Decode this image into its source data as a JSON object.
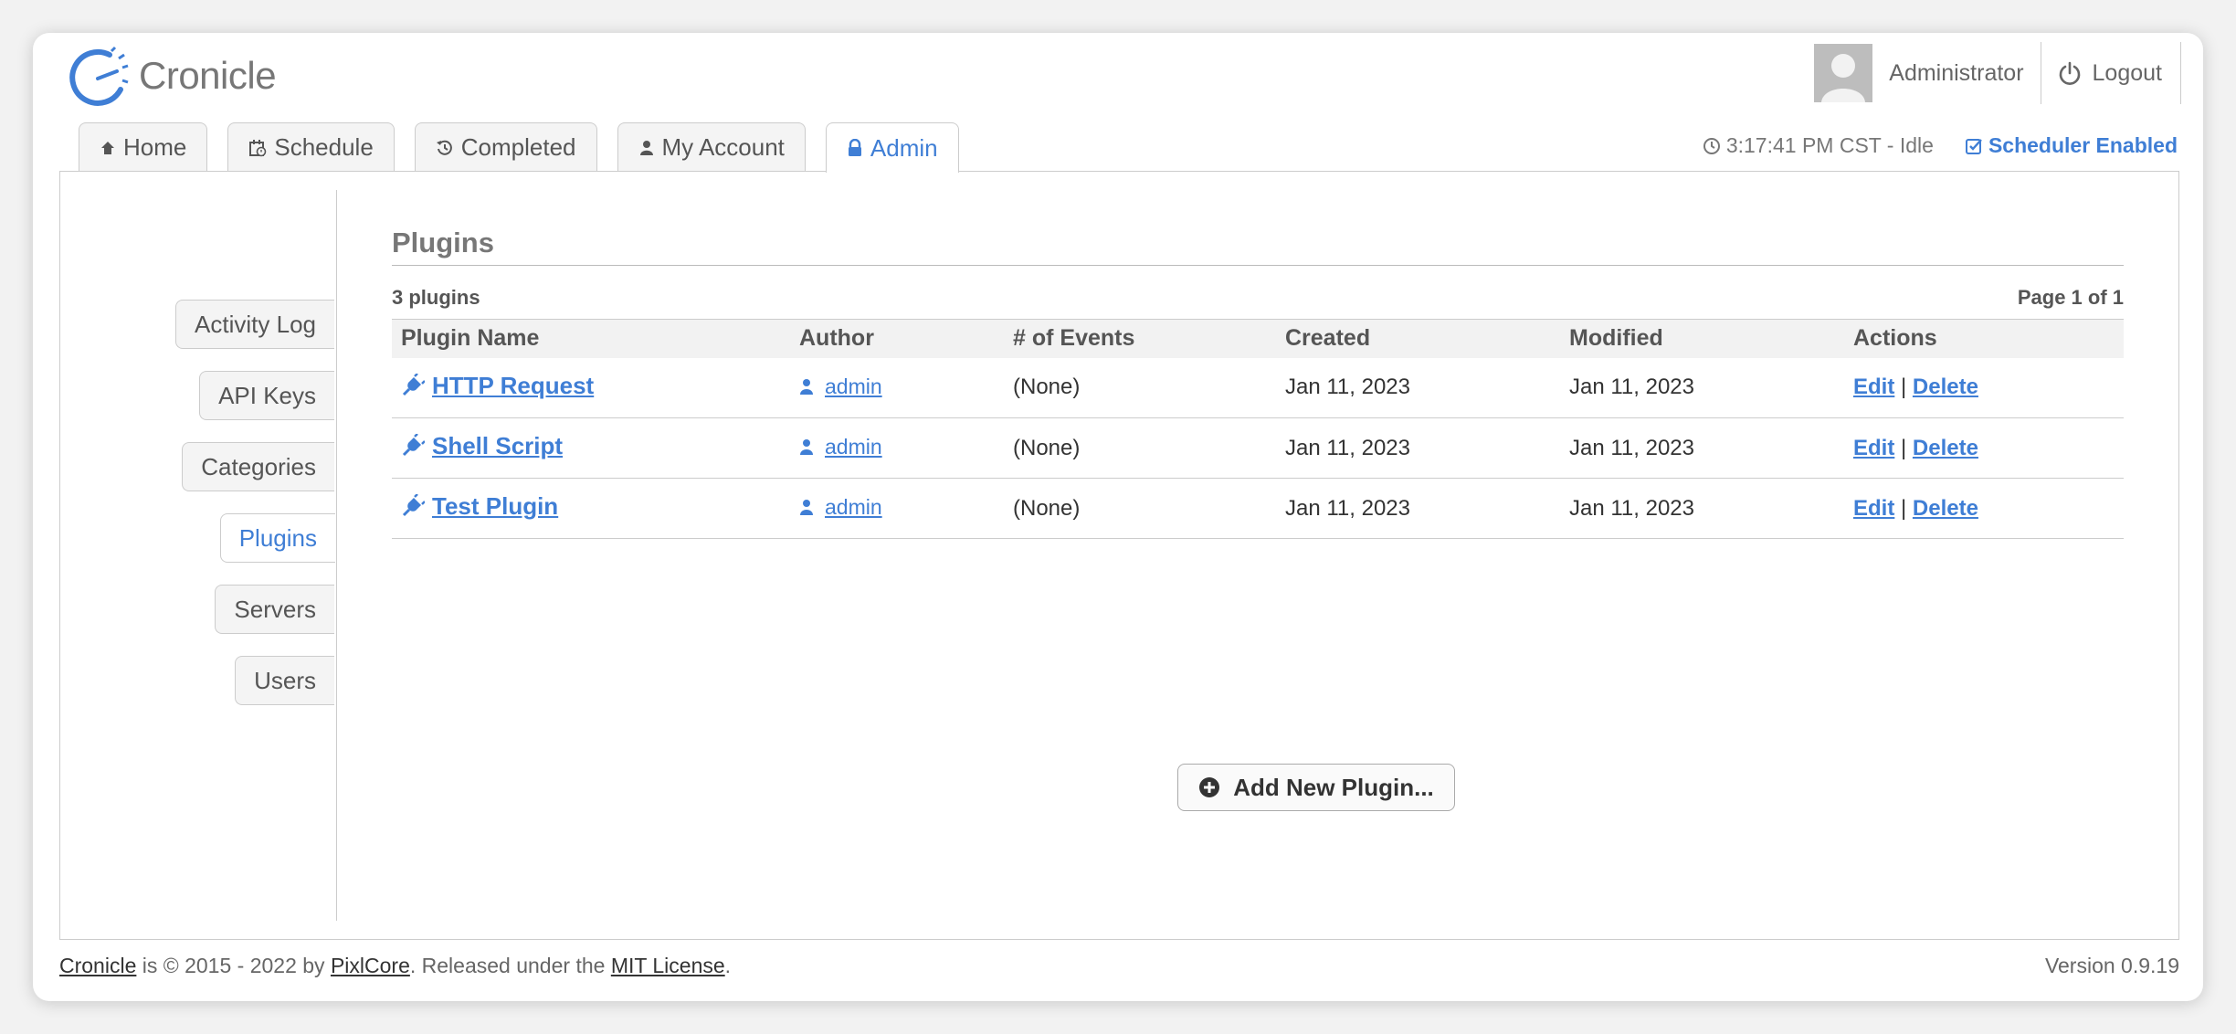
{
  "app": {
    "name": "Cronicle"
  },
  "user": {
    "name": "Administrator",
    "logout_label": "Logout"
  },
  "tabs": [
    {
      "label": "Home",
      "icon": "home-icon",
      "active": false
    },
    {
      "label": "Schedule",
      "icon": "calendar-icon",
      "active": false
    },
    {
      "label": "Completed",
      "icon": "history-icon",
      "active": false
    },
    {
      "label": "My Account",
      "icon": "user-icon",
      "active": false
    },
    {
      "label": "Admin",
      "icon": "lock-icon",
      "active": true
    }
  ],
  "status": {
    "clock": "3:17:41 PM CST - Idle",
    "scheduler": "Scheduler Enabled"
  },
  "sidebar": {
    "items": [
      {
        "label": "Activity Log",
        "active": false
      },
      {
        "label": "API Keys",
        "active": false
      },
      {
        "label": "Categories",
        "active": false
      },
      {
        "label": "Plugins",
        "active": true
      },
      {
        "label": "Servers",
        "active": false
      },
      {
        "label": "Users",
        "active": false
      }
    ]
  },
  "main": {
    "title": "Plugins",
    "count": "3 plugins",
    "page": "Page 1 of 1",
    "columns": [
      "Plugin Name",
      "Author",
      "# of Events",
      "Created",
      "Modified",
      "Actions"
    ],
    "rows": [
      {
        "name": "HTTP Request",
        "author": "admin",
        "events": "(None)",
        "created": "Jan 11, 2023",
        "modified": "Jan 11, 2023",
        "edit": "Edit",
        "sep": "|",
        "delete": "Delete"
      },
      {
        "name": "Shell Script",
        "author": "admin",
        "events": "(None)",
        "created": "Jan 11, 2023",
        "modified": "Jan 11, 2023",
        "edit": "Edit",
        "sep": "|",
        "delete": "Delete"
      },
      {
        "name": "Test Plugin",
        "author": "admin",
        "events": "(None)",
        "created": "Jan 11, 2023",
        "modified": "Jan 11, 2023",
        "edit": "Edit",
        "sep": "|",
        "delete": "Delete"
      }
    ],
    "add_button": "Add New Plugin..."
  },
  "footer": {
    "app_link": "Cronicle",
    "text1": " is © 2015 - 2022 by ",
    "company_link": "PixlCore",
    "text2": ". Released under the ",
    "license_link": "MIT License",
    "text3": ".",
    "version": "Version 0.9.19"
  },
  "colors": {
    "accent": "#3f7ed5",
    "text": "#444444",
    "border": "#cccccc"
  }
}
